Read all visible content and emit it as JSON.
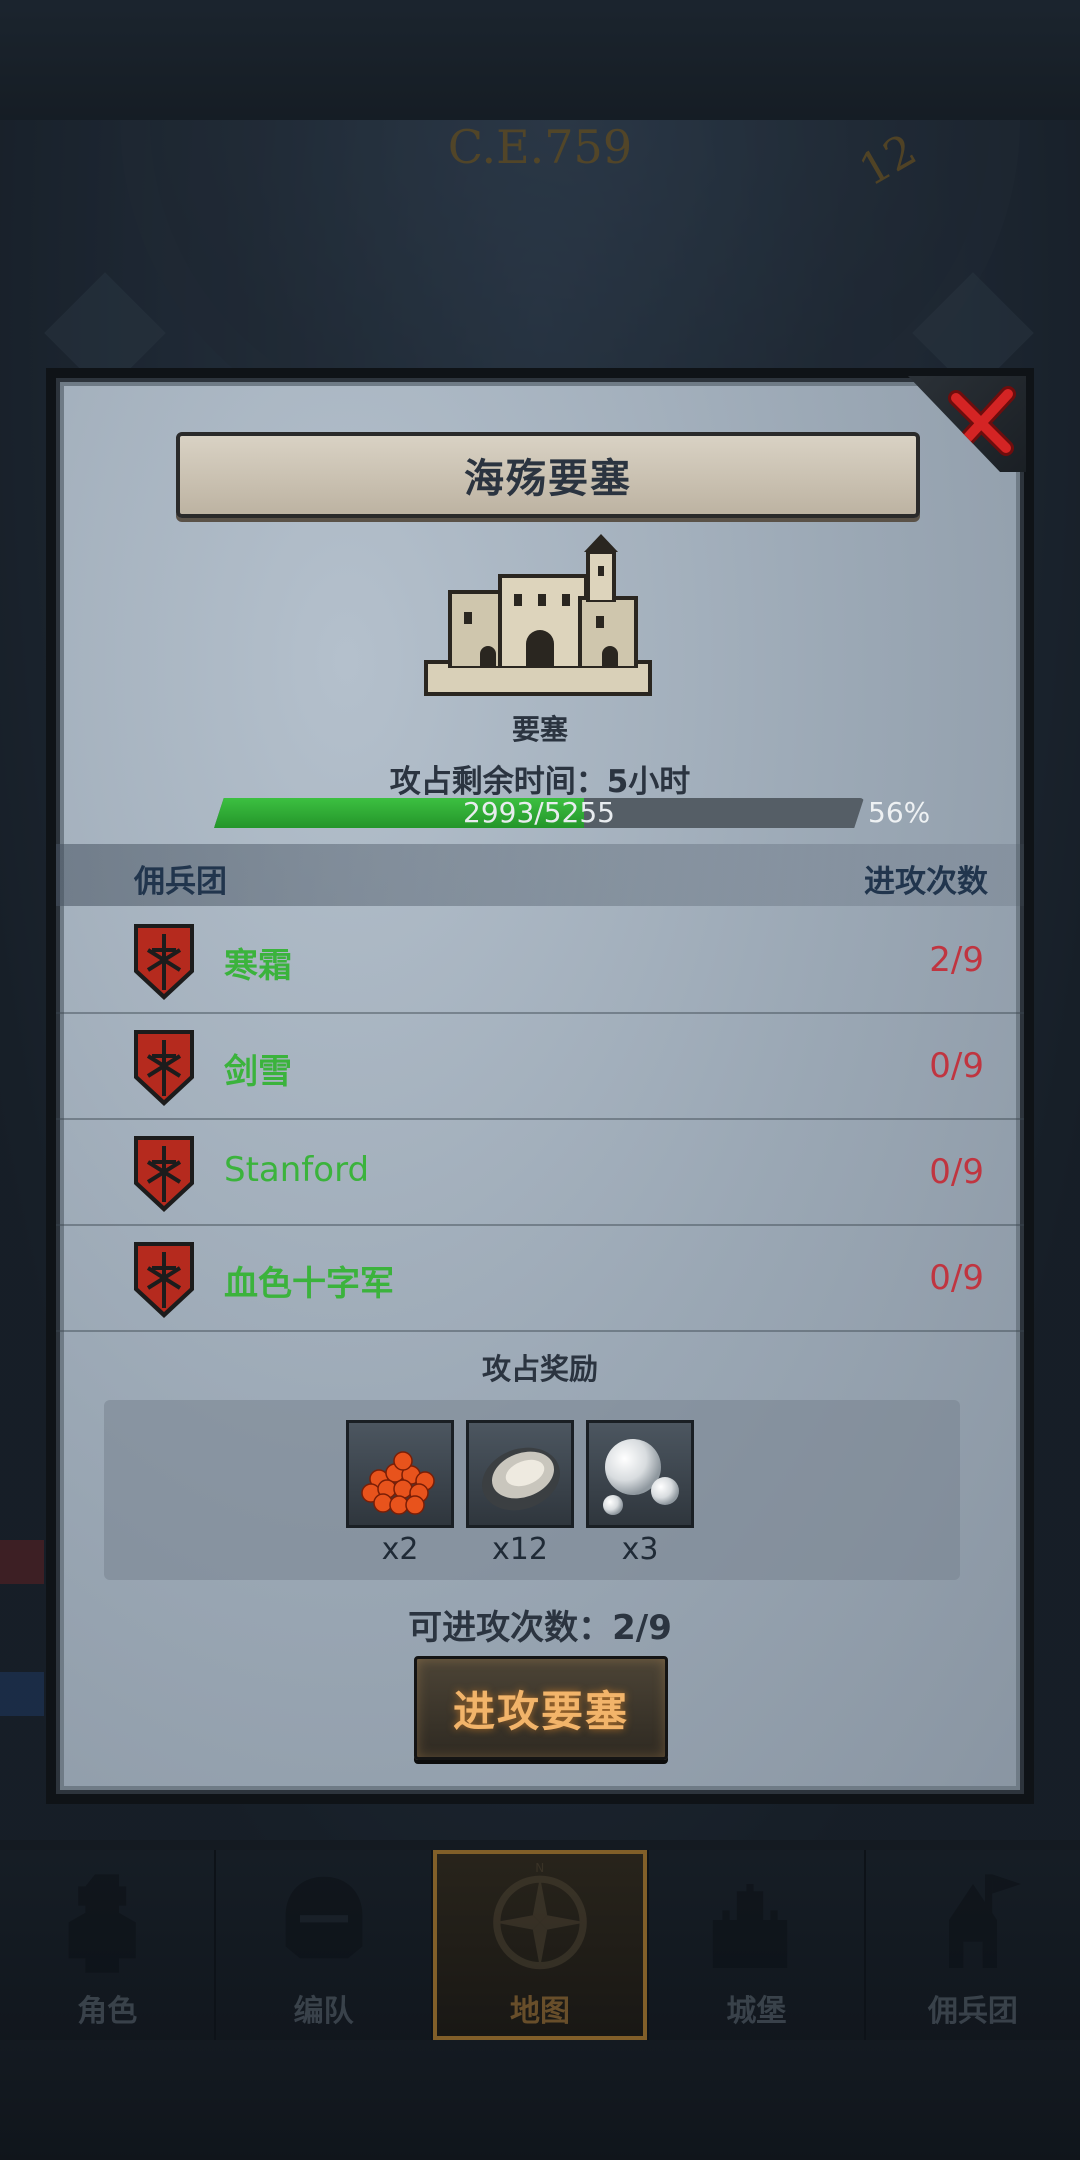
{
  "background": {
    "era_label": "C.E.759",
    "dial_marker": "12"
  },
  "dialog": {
    "title": "海殇要塞",
    "fort_type": "要塞",
    "time_label": "攻占剩余时间：5小时",
    "progress": {
      "current": 2993,
      "max": 5255,
      "text": "2993/5255",
      "percent_text": "56%",
      "percent": 56
    },
    "list_header": {
      "left": "佣兵团",
      "right": "进攻次数"
    },
    "mercenaries": [
      {
        "name": "寒霜",
        "attacks": "2/9"
      },
      {
        "name": "剑雪",
        "attacks": "0/9"
      },
      {
        "name": "Stanford",
        "attacks": "0/9"
      },
      {
        "name": "血色十字军",
        "attacks": "0/9"
      }
    ],
    "reward_title": "攻占奖励",
    "rewards": [
      {
        "icon": "salmon-roe-icon",
        "qty": "x2"
      },
      {
        "icon": "oyster-icon",
        "qty": "x12"
      },
      {
        "icon": "pearl-icon",
        "qty": "x3"
      }
    ],
    "attempts_label": "可进攻次数：2/9",
    "attack_button": "进攻要塞",
    "colors": {
      "name_green": "#3bb33c",
      "count_red": "#c03540",
      "progress_green": "#3cc041",
      "button_text": "#f2b46a"
    }
  },
  "nav": {
    "items": [
      {
        "label": "角色",
        "icon": "knight-icon"
      },
      {
        "label": "编队",
        "icon": "helmet-icon"
      },
      {
        "label": "地图",
        "icon": "compass-icon",
        "active": true
      },
      {
        "label": "城堡",
        "icon": "castle-icon"
      },
      {
        "label": "佣兵团",
        "icon": "mercenary-icon"
      }
    ]
  }
}
